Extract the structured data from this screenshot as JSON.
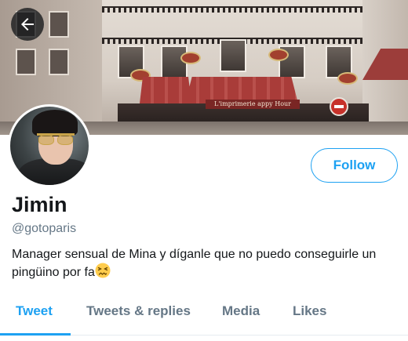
{
  "banner": {
    "awning_text": "L'imprimerie   appy Hour"
  },
  "profile": {
    "display_name": "Jimin",
    "handle": "@gotoparis",
    "bio": "Manager sensual de Mina y díganle que no puedo conseguirle un pingüino por fa",
    "bio_emoji": "confounded-face-emoji"
  },
  "actions": {
    "follow_label": "Follow"
  },
  "tabs": [
    {
      "label": "Tweet",
      "active": true
    },
    {
      "label": "Tweets & replies",
      "active": false
    },
    {
      "label": "Media",
      "active": false
    },
    {
      "label": "Likes",
      "active": false
    }
  ],
  "colors": {
    "accent": "#1da1f2",
    "text_primary": "#14171a",
    "text_secondary": "#657786"
  },
  "icons": {
    "back": "arrow-left-icon"
  }
}
